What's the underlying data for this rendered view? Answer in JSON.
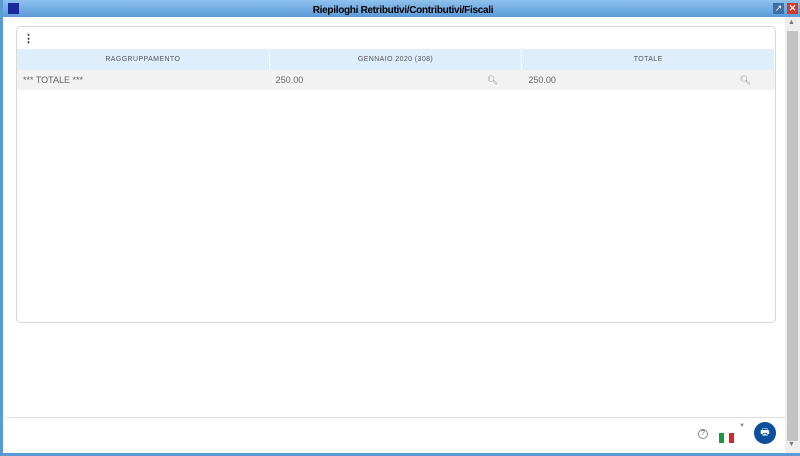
{
  "window": {
    "title": "Riepiloghi Retributivi/Contributivi/Fiscali"
  },
  "table": {
    "headers": [
      "RAGGRUPPAMENTO",
      "GENNAIO 2020 (308)",
      "TOTALE"
    ],
    "rows": [
      {
        "group": "*** TOTALE ***",
        "gennaio": "250.00",
        "totale": "250.00"
      }
    ]
  },
  "footer": {
    "help": "?",
    "language": "it"
  }
}
